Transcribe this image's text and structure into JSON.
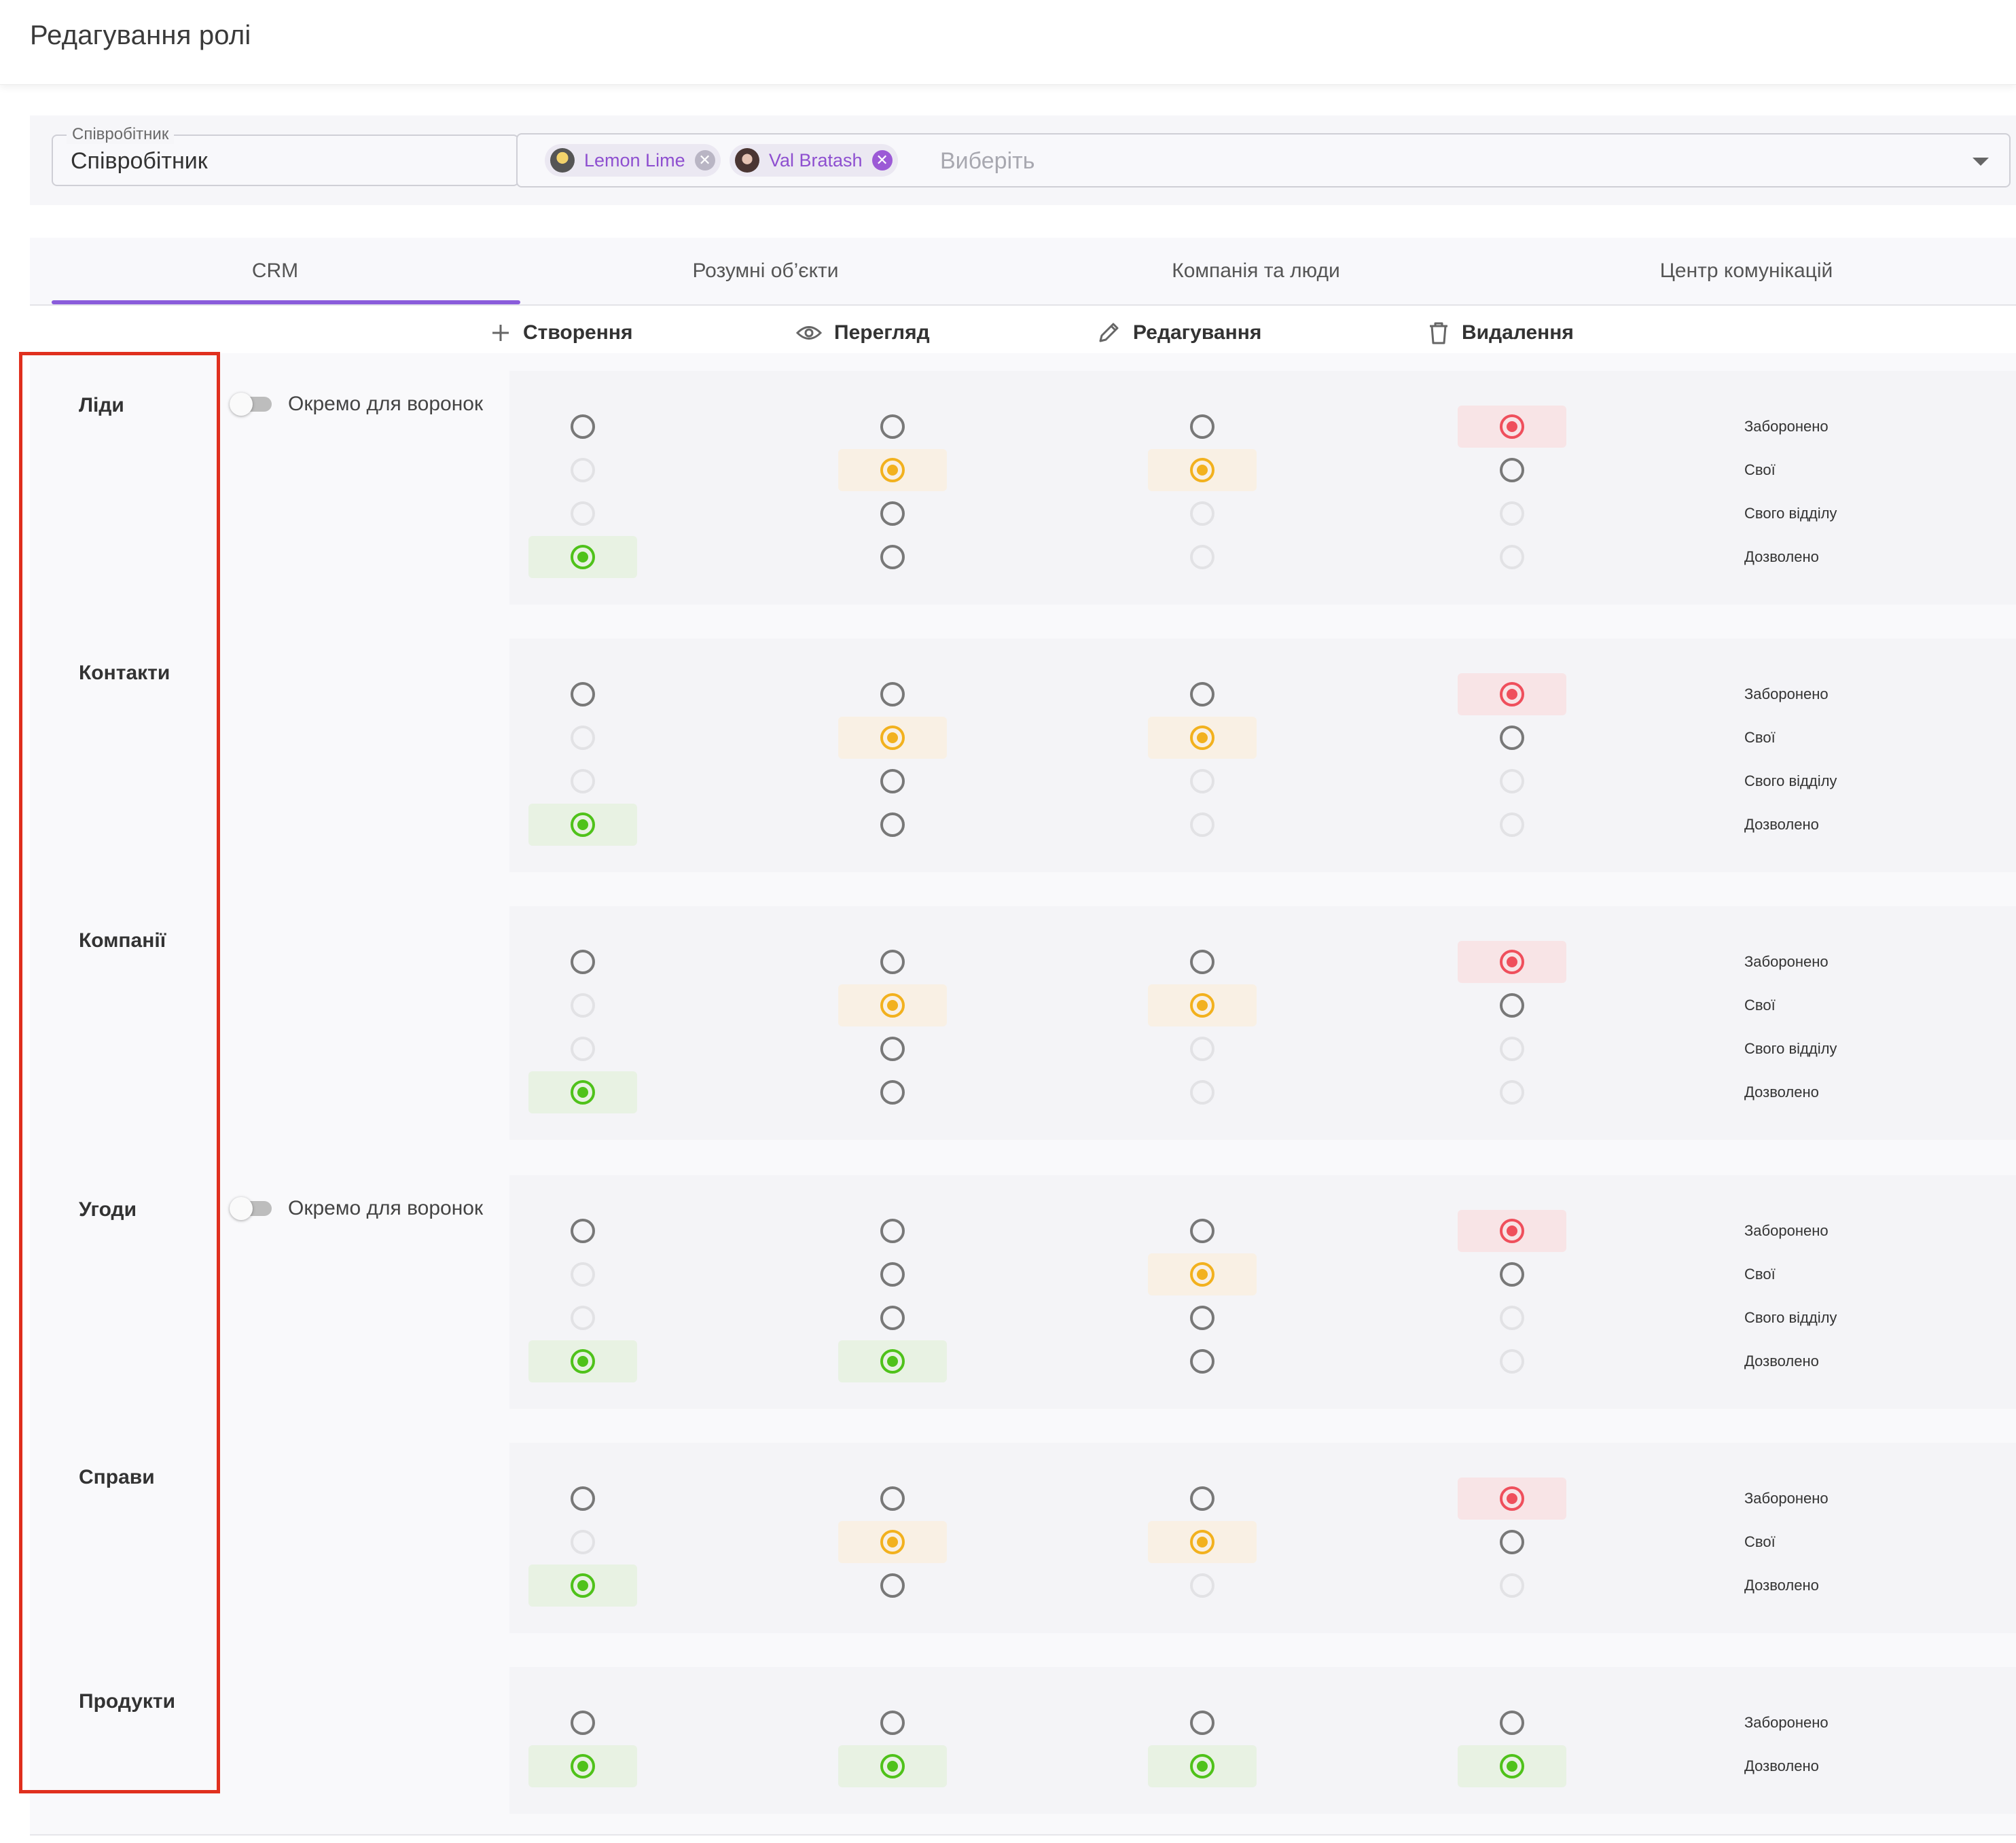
{
  "header": {
    "title": "Редагування ролі"
  },
  "filters": {
    "role_legend": "Співробітник",
    "role_value": "Співробітник",
    "employees": [
      {
        "name": "Lemon Lime",
        "avatar_color": "#6b6b6b"
      },
      {
        "name": "Val Bratash",
        "avatar_color": "#8c6a63"
      }
    ],
    "placeholder": "Виберіть"
  },
  "tabs": [
    "CRM",
    "Розумні об’єкти",
    "Компанія та люди",
    "Центр комунікацій"
  ],
  "active_tab": 0,
  "permissions": [
    {
      "label": "Створення",
      "icon": "plus-icon"
    },
    {
      "label": "Перегляд",
      "icon": "eye-icon"
    },
    {
      "label": "Редагування",
      "icon": "pencil-icon"
    },
    {
      "label": "Видалення",
      "icon": "trash-icon"
    }
  ],
  "toggle_label": "Окремо для воронок",
  "sections": [
    {
      "name": "Ліди",
      "toggle": true,
      "levels": [
        "Заборонено",
        "Свої",
        "Свого відділу",
        "Дозволено"
      ],
      "cells": [
        [
          "n",
          "n",
          "n",
          "red"
        ],
        [
          "d",
          "orange",
          "orange",
          "n"
        ],
        [
          "d",
          "n",
          "d",
          "d"
        ],
        [
          "green",
          "n",
          "d",
          "d"
        ]
      ]
    },
    {
      "name": "Контакти",
      "toggle": false,
      "levels": [
        "Заборонено",
        "Свої",
        "Свого відділу",
        "Дозволено"
      ],
      "cells": [
        [
          "n",
          "n",
          "n",
          "red"
        ],
        [
          "d",
          "orange",
          "orange",
          "n"
        ],
        [
          "d",
          "n",
          "d",
          "d"
        ],
        [
          "green",
          "n",
          "d",
          "d"
        ]
      ]
    },
    {
      "name": "Компанії",
      "toggle": false,
      "levels": [
        "Заборонено",
        "Свої",
        "Свого відділу",
        "Дозволено"
      ],
      "cells": [
        [
          "n",
          "n",
          "n",
          "red"
        ],
        [
          "d",
          "orange",
          "orange",
          "n"
        ],
        [
          "d",
          "n",
          "d",
          "d"
        ],
        [
          "green",
          "n",
          "d",
          "d"
        ]
      ]
    },
    {
      "name": "Угоди",
      "toggle": true,
      "levels": [
        "Заборонено",
        "Свої",
        "Свого відділу",
        "Дозволено"
      ],
      "cells": [
        [
          "n",
          "n",
          "n",
          "red"
        ],
        [
          "d",
          "n",
          "orange",
          "n"
        ],
        [
          "d",
          "n",
          "n",
          "d"
        ],
        [
          "green",
          "green",
          "n",
          "d"
        ]
      ]
    },
    {
      "name": "Справи",
      "toggle": false,
      "levels": [
        "Заборонено",
        "Свої",
        "Дозволено"
      ],
      "cells": [
        [
          "n",
          "n",
          "n",
          "red"
        ],
        [
          "d",
          "orange",
          "orange",
          "n"
        ],
        [
          "green",
          "n",
          "d",
          "d"
        ]
      ]
    },
    {
      "name": "Продукти",
      "toggle": false,
      "levels": [
        "Заборонено",
        "Дозволено"
      ],
      "cells": [
        [
          "n",
          "n",
          "n",
          "n"
        ],
        [
          "green",
          "green",
          "green",
          "green"
        ]
      ]
    }
  ],
  "colors": {
    "accent": "#8a5cdb",
    "allowed": "#4fc21a",
    "own": "#f2b11e",
    "forbidden": "#ef4f5c",
    "highlight_box": "#e0301e"
  }
}
